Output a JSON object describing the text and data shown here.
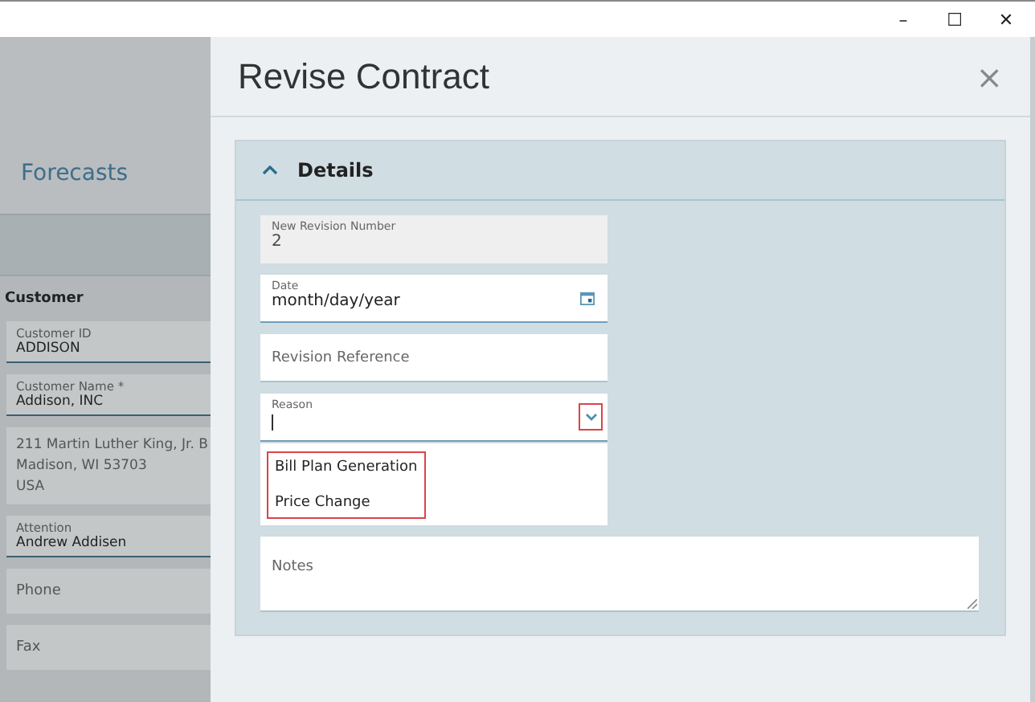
{
  "window": {
    "controls": [
      "–",
      "☐",
      "✕"
    ]
  },
  "background_page": {
    "section_title": "Forecasts",
    "group_title": "Customer",
    "fields": [
      {
        "label": "Customer ID",
        "value": "ADDISON",
        "kind": "labeled"
      },
      {
        "label": "Customer Name *",
        "value": "Addison, INC",
        "kind": "labeled"
      },
      {
        "lines": [
          "211 Martin Luther King, Jr. B",
          "Madison, WI  53703",
          "USA"
        ],
        "kind": "address"
      },
      {
        "label": "Attention",
        "value": "Andrew Addisen",
        "kind": "labeled"
      },
      {
        "placeholder": "Phone",
        "kind": "empty"
      },
      {
        "placeholder": "Fax",
        "kind": "empty"
      }
    ]
  },
  "dialog": {
    "title": "Revise Contract",
    "close": "×",
    "section": {
      "title": "Details",
      "expanded": true,
      "fields": [
        {
          "label": "New Revision Number",
          "value": "2",
          "kind": "readonly"
        },
        {
          "label": "Date",
          "value": "month/day/year",
          "kind": "date"
        },
        {
          "placeholder": "Revision Reference",
          "kind": "text"
        },
        {
          "label": "Reason",
          "kind": "select",
          "expanded": true,
          "highlighted": true,
          "options": [
            "Bill Plan Generation",
            "Price Change"
          ],
          "options_highlighted": true
        }
      ],
      "notes": {
        "placeholder": "Notes"
      }
    }
  }
}
